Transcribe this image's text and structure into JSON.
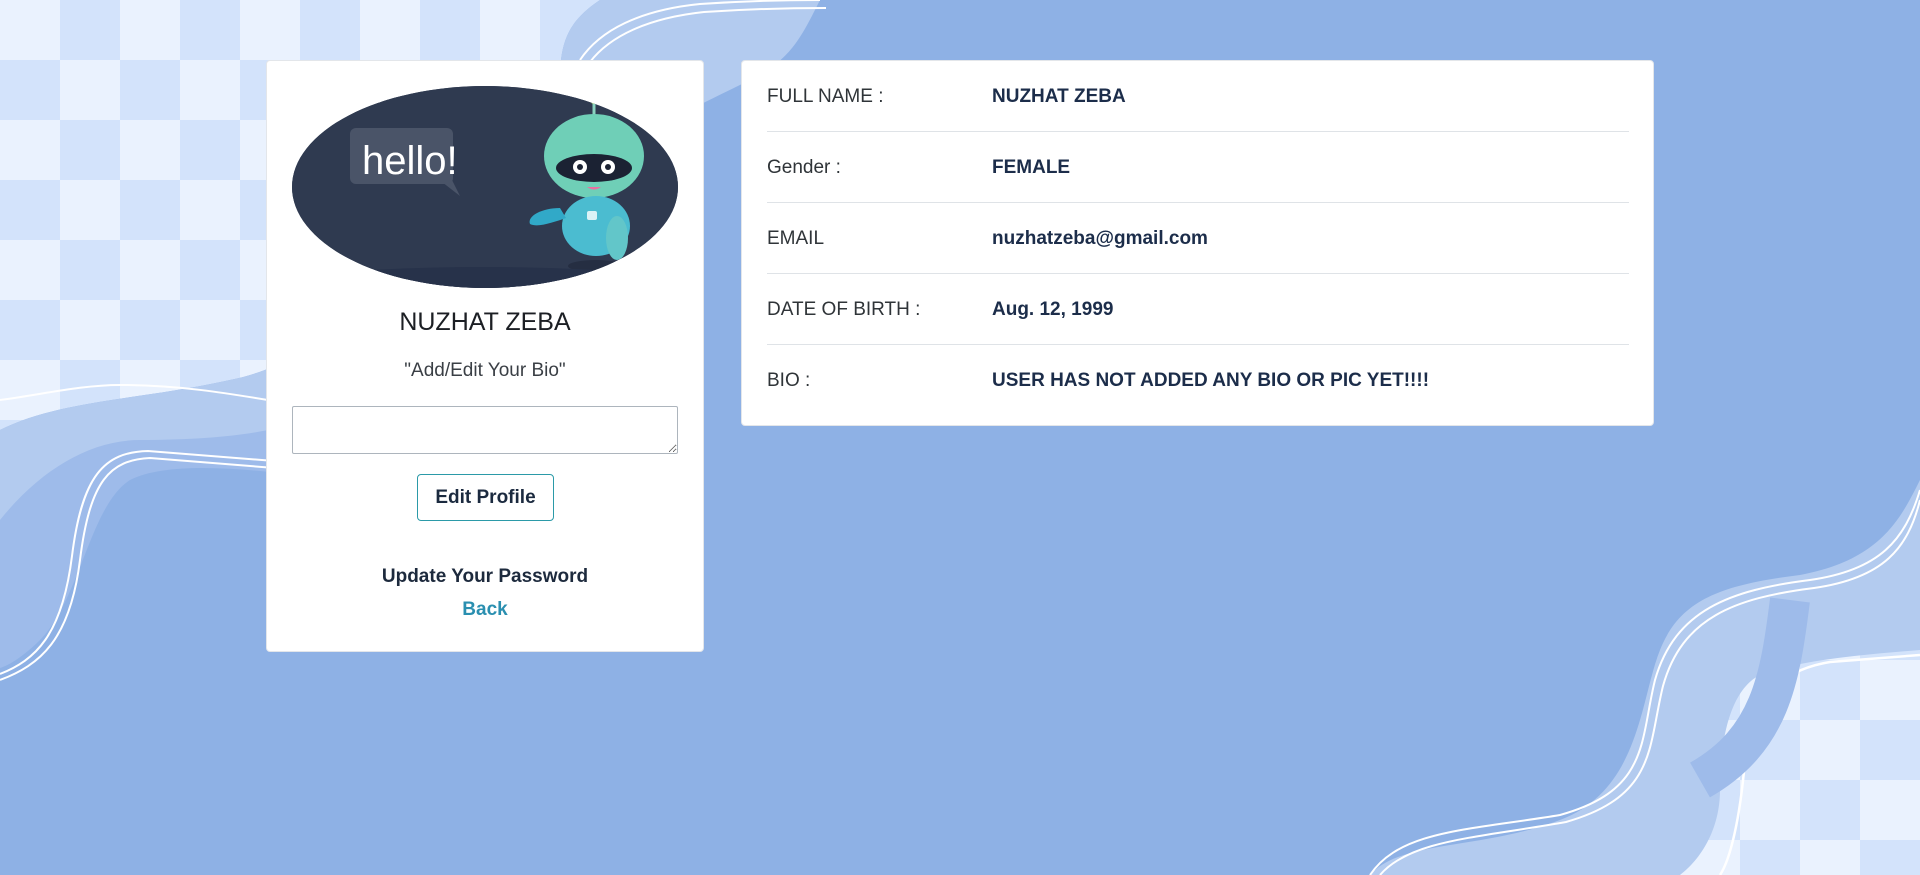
{
  "profile": {
    "name": "NUZHAT ZEBA",
    "bio_hint": "\"Add/Edit Your Bio\"",
    "bio_value": "",
    "avatar_text": "hello!",
    "edit_button": "Edit Profile",
    "password_link": "Update Your Password",
    "back_link": "Back"
  },
  "details": [
    {
      "label": "FULL NAME :",
      "value": "NUZHAT ZEBA"
    },
    {
      "label": "Gender :",
      "value": "FEMALE"
    },
    {
      "label": "EMAIL",
      "value": "nuzhatzeba@gmail.com"
    },
    {
      "label": "DATE OF BIRTH :",
      "value": "Aug. 12, 1999"
    },
    {
      "label": "BIO :",
      "value": "USER HAS NOT ADDED ANY BIO OR PIC YET!!!!"
    }
  ],
  "colors": {
    "background": "#8eb1e5",
    "accent": "#2b9aa8",
    "link": "#2a8fb0",
    "value_text": "#1c2d4a"
  }
}
